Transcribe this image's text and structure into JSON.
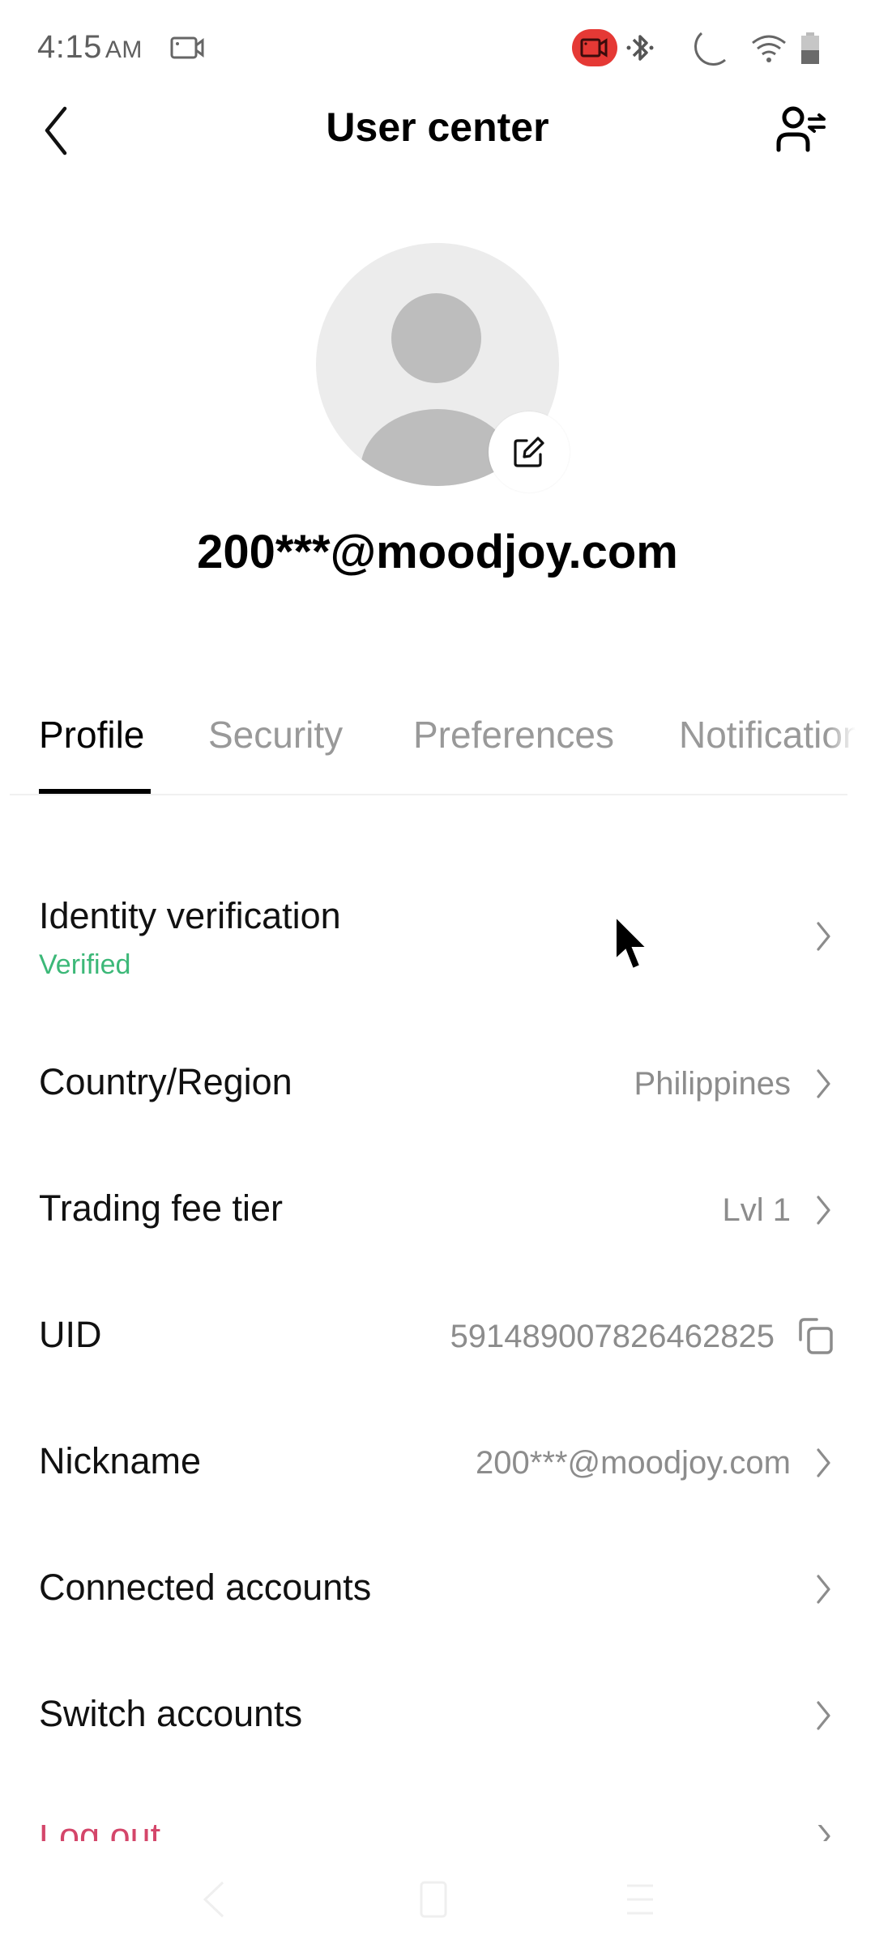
{
  "status_bar": {
    "time": "4:15",
    "ampm": "AM",
    "icons": [
      "screen-record-icon",
      "screen-recording-active-icon",
      "bluetooth-icon",
      "do-not-disturb-moon-icon",
      "wifi-icon",
      "battery-icon"
    ],
    "recording_color": "#e53935"
  },
  "header": {
    "title": "User center",
    "back_icon": "chevron-left-icon",
    "switch_account_icon": "user-switch-icon"
  },
  "profile": {
    "avatar_icon": "default-avatar-icon",
    "edit_icon": "edit-pencil-icon",
    "email": "200***@moodjoy.com"
  },
  "tabs": [
    {
      "label": "Profile",
      "active": true
    },
    {
      "label": "Security",
      "active": false
    },
    {
      "label": "Preferences",
      "active": false
    },
    {
      "label": "Notifications",
      "active": false
    }
  ],
  "rows": [
    {
      "label": "Identity verification",
      "sub": "Verified",
      "value": "",
      "action": "chevron-right-icon"
    },
    {
      "label": "Country/Region",
      "value": "Philippines",
      "action": "chevron-right-icon"
    },
    {
      "label": "Trading fee tier",
      "value": "Lvl 1",
      "action": "chevron-right-icon"
    },
    {
      "label": "UID",
      "value": "591489007826462825",
      "action": "copy-icon"
    },
    {
      "label": "Nickname",
      "value": "200***@moodjoy.com",
      "action": "chevron-right-icon"
    },
    {
      "label": "Connected accounts",
      "value": "",
      "action": "chevron-right-icon"
    },
    {
      "label": "Switch accounts",
      "value": "",
      "action": "chevron-right-icon"
    },
    {
      "label": "Log out",
      "value": "",
      "action": "chevron-right-icon"
    }
  ],
  "colors": {
    "verified": "#3cb878",
    "logout": "#d4466a",
    "muted": "#8c8c8c"
  },
  "nav_bar": [
    "back-nav-icon",
    "home-nav-icon",
    "recents-nav-icon"
  ]
}
